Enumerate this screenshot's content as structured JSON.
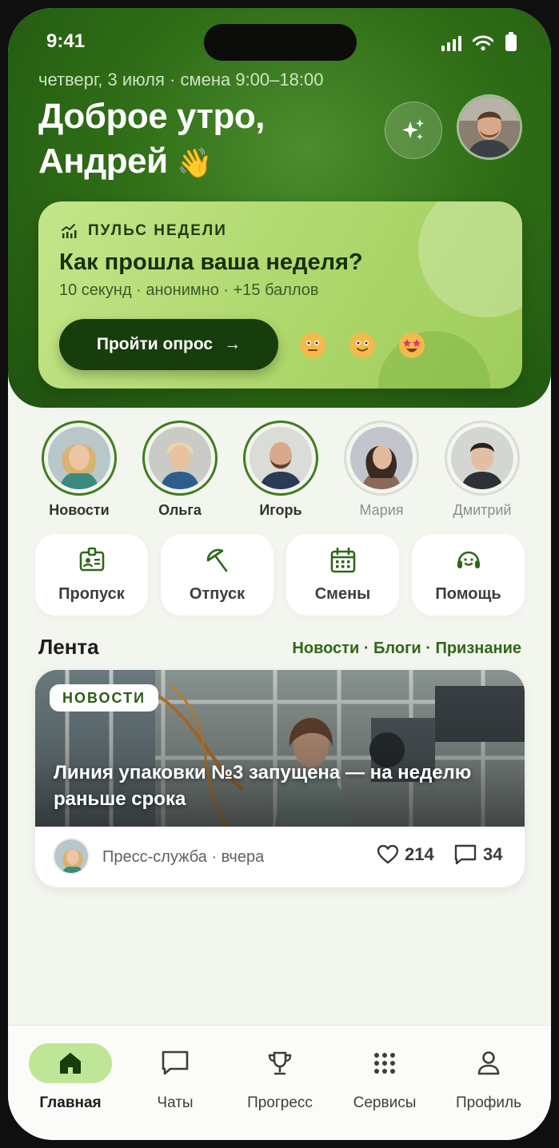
{
  "status_bar": {
    "time": "9:41"
  },
  "header": {
    "date_line": "четверг, 3 июля · смена 9:00–18:00",
    "greeting_line1": "Доброе утро,",
    "greeting_line2": "Андрей",
    "wave_emoji": "👋"
  },
  "pulse": {
    "label": "ПУЛЬС НЕДЕЛИ",
    "title": "Как прошла ваша неделя?",
    "subtitle": "10 секунд · анонимно · +15 баллов",
    "button": "Пройти опрос",
    "button_arrow": "→"
  },
  "stories": [
    {
      "name": "Новости",
      "seen": false
    },
    {
      "name": "Ольга",
      "seen": false
    },
    {
      "name": "Игорь",
      "seen": false
    },
    {
      "name": "Мария",
      "seen": true
    },
    {
      "name": "Дмитрий",
      "seen": true
    }
  ],
  "quick_actions": [
    {
      "label": "Пропуск",
      "icon": "badge-icon"
    },
    {
      "label": "Отпуск",
      "icon": "umbrella-icon"
    },
    {
      "label": "Смены",
      "icon": "calendar-icon"
    },
    {
      "label": "Помощь",
      "icon": "headset-icon"
    }
  ],
  "feed": {
    "title": "Лента",
    "tabs": "Новости · Блоги · Признание",
    "card": {
      "badge": "НОВОСТИ",
      "headline": "Линия упаковки №3 запущена — на неделю раньше срока",
      "author": "Пресс-служба · вчера",
      "likes": "214",
      "comments": "34"
    }
  },
  "bottom_nav": [
    {
      "label": "Главная",
      "icon": "home-icon",
      "active": true
    },
    {
      "label": "Чаты",
      "icon": "chat-icon",
      "active": false
    },
    {
      "label": "Прогресс",
      "icon": "trophy-icon",
      "active": false
    },
    {
      "label": "Сервисы",
      "icon": "grid-icon",
      "active": false
    },
    {
      "label": "Профиль",
      "icon": "profile-icon",
      "active": false
    }
  ],
  "colors": {
    "header_green": "#2f6d16",
    "accent_dark": "#173d0d",
    "accent_text": "#2e6818",
    "active_pill": "#bfe596"
  }
}
